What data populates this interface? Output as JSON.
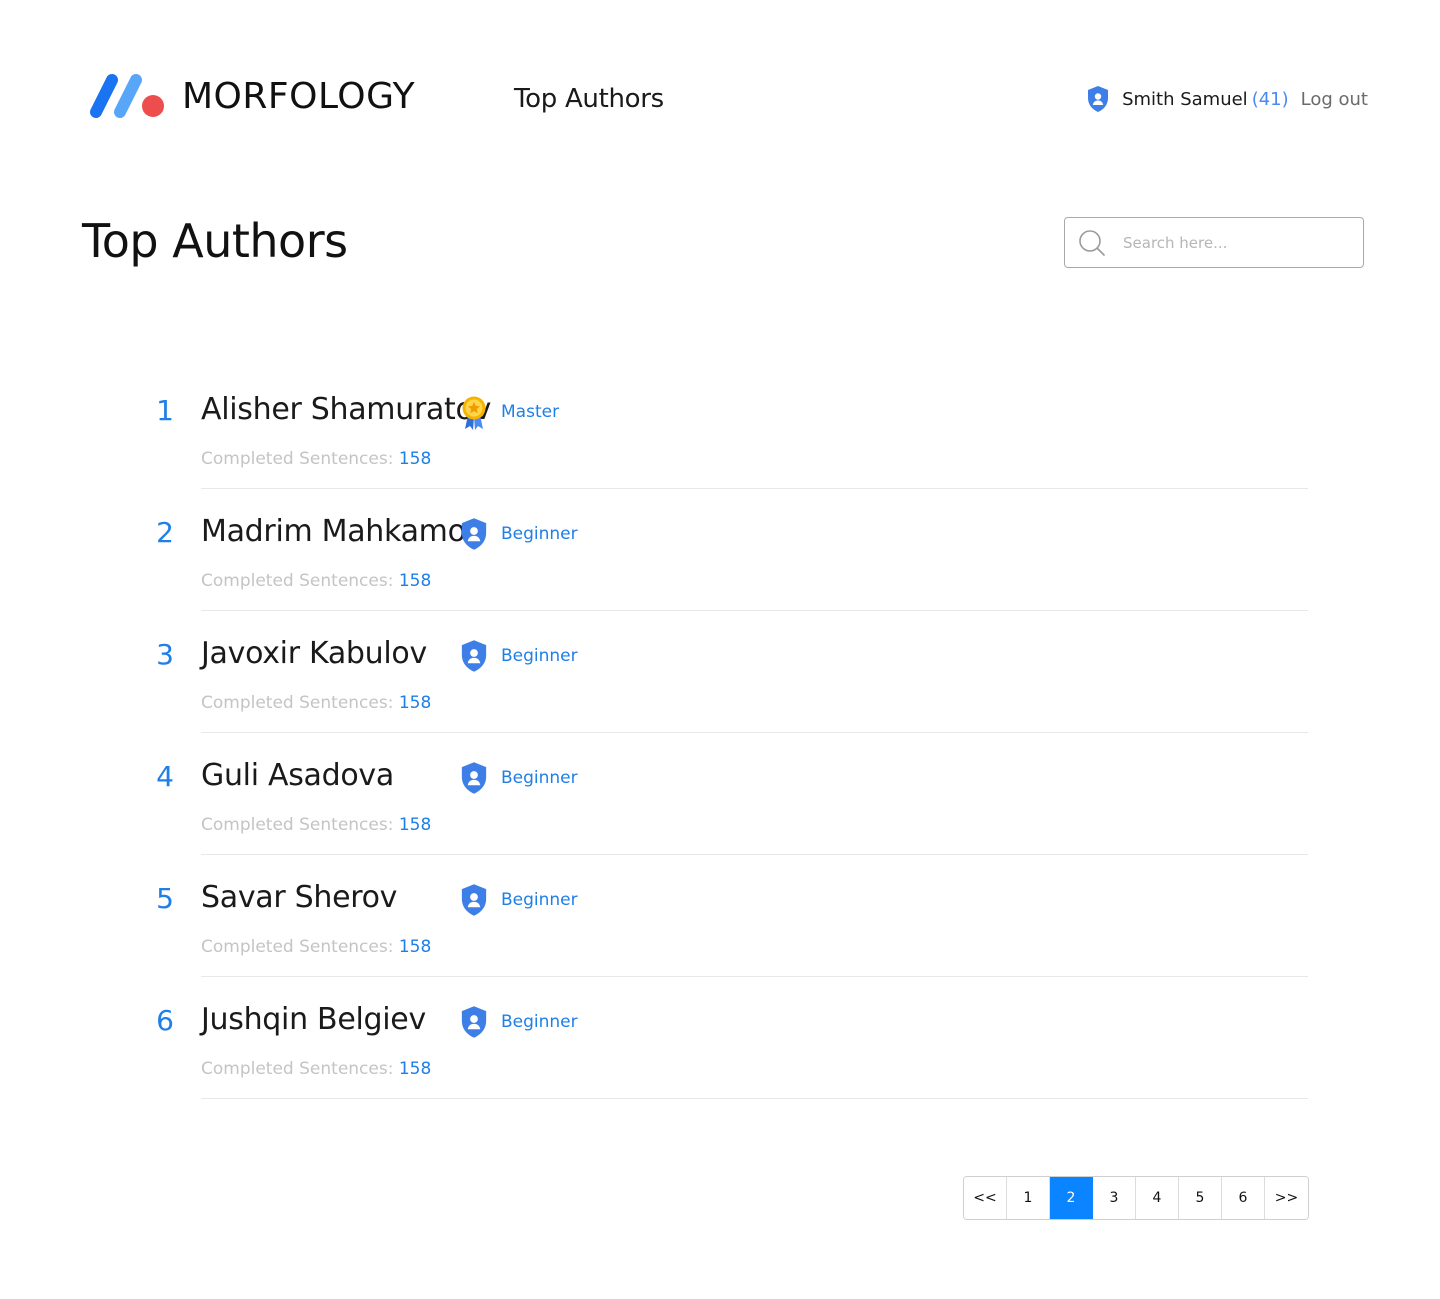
{
  "header": {
    "brand": "MORFOLOGY",
    "nav_link": "Top Authors",
    "user": {
      "name": "Smith Samuel",
      "score": "(41)",
      "logout": "Log out"
    }
  },
  "page": {
    "title": "Top Authors",
    "search_placeholder": "Search here..."
  },
  "colors": {
    "accent": "#1e7fe8",
    "active_page": "#0a84ff",
    "logo_blue_dark": "#1a73f0",
    "logo_blue_light": "#58a6f7",
    "logo_red": "#ee4d4d"
  },
  "authors": [
    {
      "rank": "1",
      "name": "Alisher Shamuratov",
      "badge": "Master",
      "badge_icon": "medal-icon",
      "stat_label": "Completed Sentences:",
      "stat_value": "158"
    },
    {
      "rank": "2",
      "name": "Madrim Mahkamov",
      "badge": "Beginner",
      "badge_icon": "shield-user-icon",
      "stat_label": "Completed Sentences:",
      "stat_value": "158"
    },
    {
      "rank": "3",
      "name": "Javoxir Kabulov",
      "badge": "Beginner",
      "badge_icon": "shield-user-icon",
      "stat_label": "Completed Sentences:",
      "stat_value": "158"
    },
    {
      "rank": "4",
      "name": "Guli Asadova",
      "badge": "Beginner",
      "badge_icon": "shield-user-icon",
      "stat_label": "Completed Sentences:",
      "stat_value": "158"
    },
    {
      "rank": "5",
      "name": "Savar Sherov",
      "badge": "Beginner",
      "badge_icon": "shield-user-icon",
      "stat_label": "Completed Sentences:",
      "stat_value": "158"
    },
    {
      "rank": "6",
      "name": "Jushqin Belgiev",
      "badge": "Beginner",
      "badge_icon": "shield-user-icon",
      "stat_label": "Completed Sentences:",
      "stat_value": "158"
    }
  ],
  "pagination": {
    "prev": "<<",
    "pages": [
      "1",
      "2",
      "3",
      "4",
      "5",
      "6"
    ],
    "current": "2",
    "next": ">>"
  }
}
